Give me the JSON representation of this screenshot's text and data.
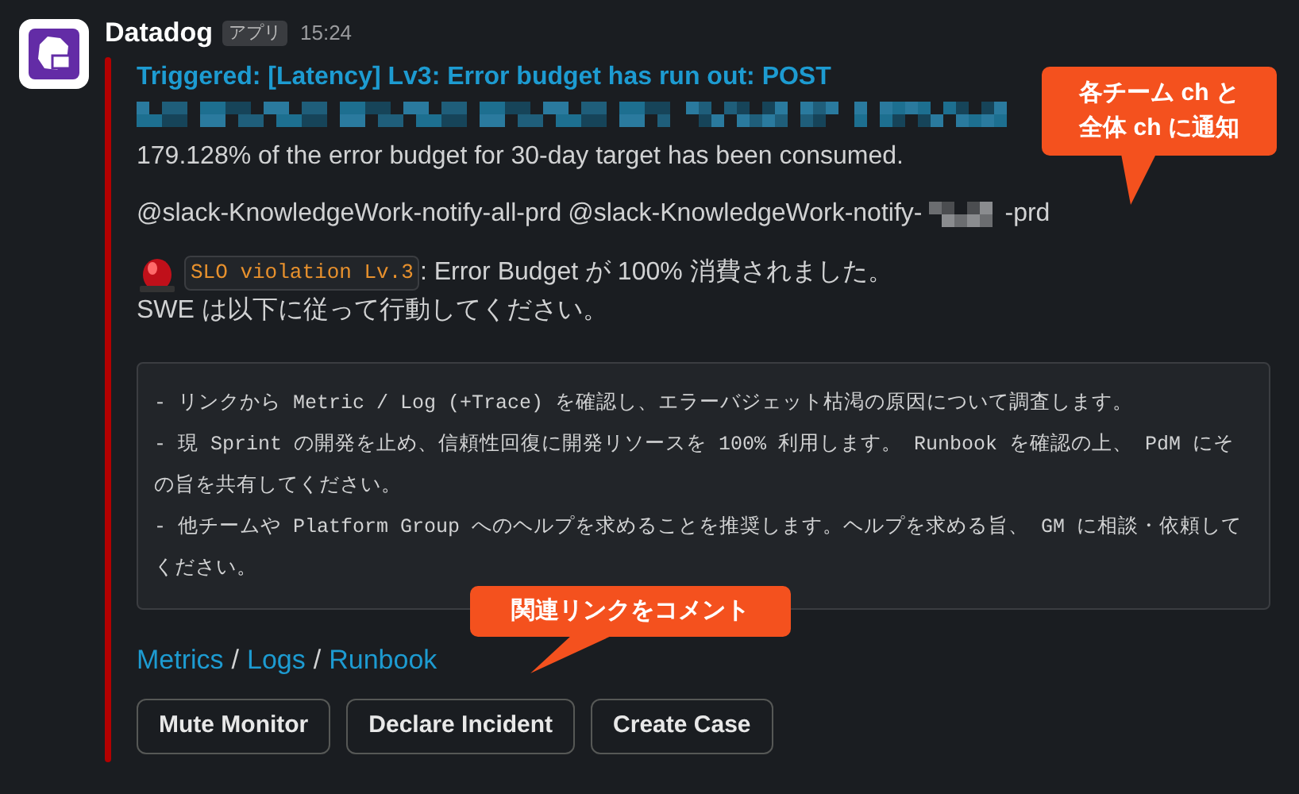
{
  "message": {
    "sender": "Datadog",
    "app_badge": "アプリ",
    "time": "15:24"
  },
  "attachment": {
    "title": "Triggered: [Latency] Lv3: Error budget has run out: POST",
    "summary": "179.128% of the error budget for 30-day target has been consumed.",
    "mentions": [
      {
        "text": "@slack-KnowledgeWork-notify-all-prd"
      },
      {
        "text": "@slack-KnowledgeWork-notify-",
        "suffix": "-prd"
      }
    ],
    "alert_tag": "SLO violation Lv.3",
    "alert_text": ": Error Budget が 100% 消費されました。",
    "instruction": "SWE は以下に従って行動してください。",
    "code_lines": [
      "- リンクから Metric / Log (+Trace) を確認し、エラーバジェット枯渇の原因について調査します。",
      "- 現 Sprint の開発を止め、信頼性回復に開発リソースを 100% 利用します。 Runbook を確認の上、 PdM にその旨を共有してください。",
      "- 他チームや Platform Group へのヘルプを求めることを推奨します。ヘルプを求める旨、 GM に相談・依頼してください。"
    ],
    "links": [
      "Metrics",
      "Logs",
      "Runbook"
    ],
    "link_separator": "/",
    "buttons": [
      "Mute Monitor",
      "Declare Incident",
      "Create Case"
    ]
  },
  "callouts": [
    {
      "lines": [
        "各チーム ch と",
        "全体 ch に通知"
      ]
    },
    {
      "lines": [
        "関連リンクをコメント"
      ]
    }
  ]
}
